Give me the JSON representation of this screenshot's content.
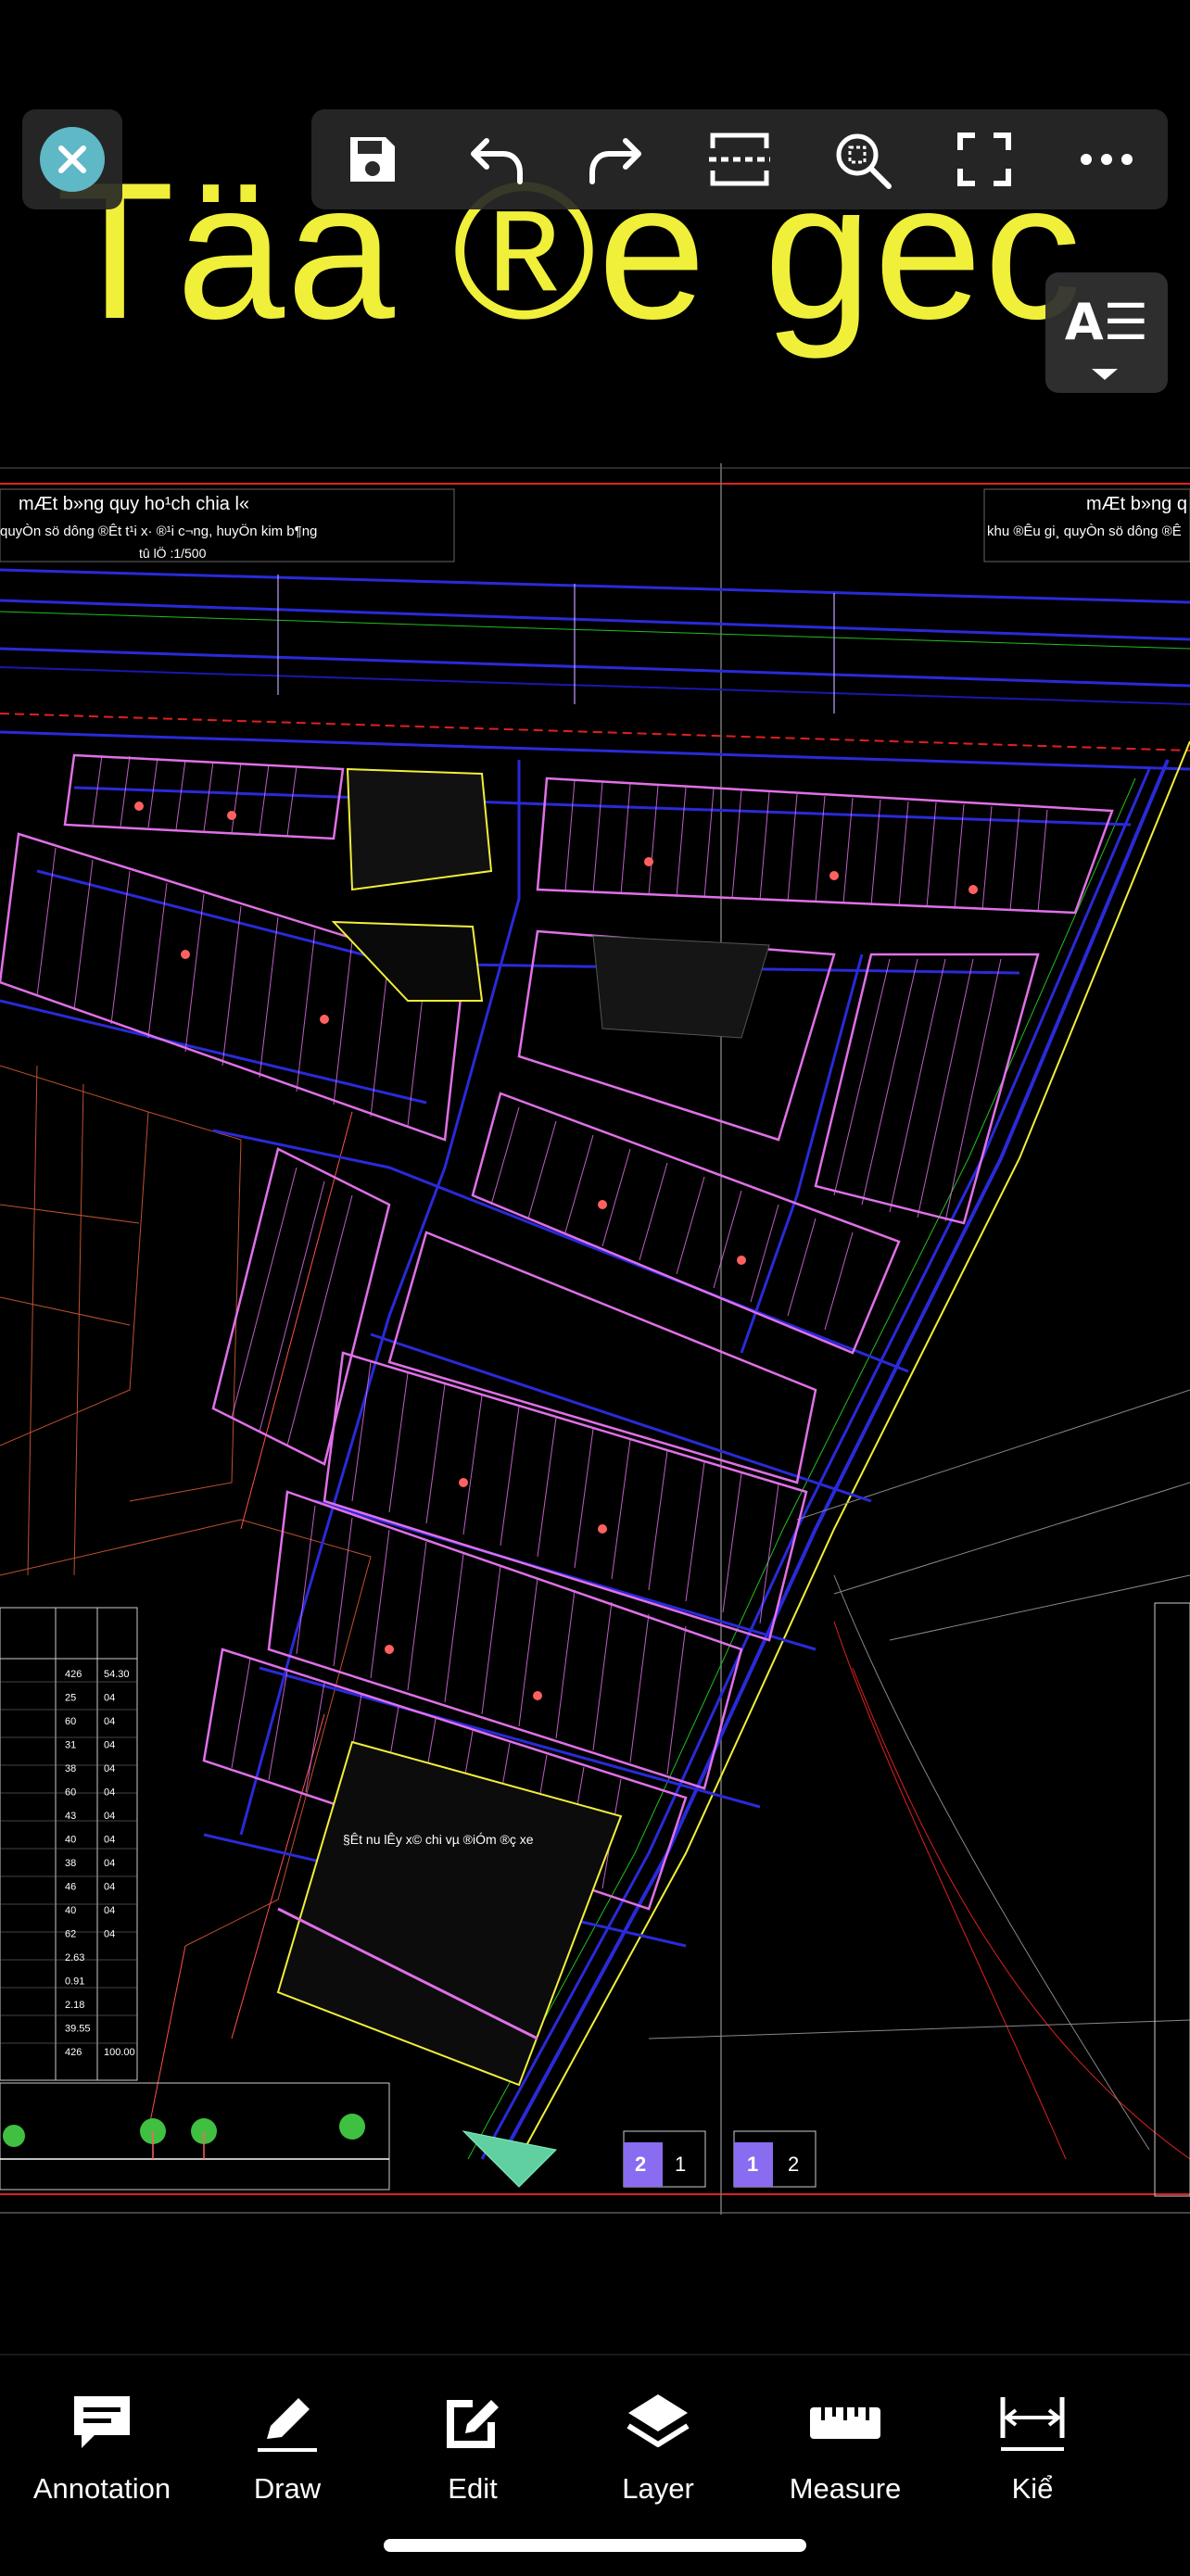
{
  "drawing": {
    "big_title": "Täa ®e gec",
    "title_left_line1": "mÆt b»ng quy ho¹ch chia l«",
    "title_left_line2": "quyÒn sö dông ®Êt t¹i x· ®¹i c­¬ng, huyÖn kim b¶ng",
    "title_left_line3": "tû lÖ :1/500",
    "title_right_line1": "mÆt b»ng q",
    "title_right_line2": "khu ®Êu gi¸ quyÒn sö dông ®Ê",
    "area_label": "§Êt nu lÊy x© chi vµ ®iÓm ®ç xe",
    "page_box_a": [
      "2",
      "1"
    ],
    "page_box_b": [
      "1",
      "2"
    ],
    "table_values": [
      "426",
      "25",
      "60",
      "31",
      "38",
      "60",
      "43",
      "40",
      "38",
      "46",
      "40",
      "62",
      "2.63",
      "0.91",
      "2.18",
      "39.55",
      "426"
    ],
    "table_units": [
      "54.30",
      "04",
      "04",
      "04",
      "04",
      "04",
      "04",
      "04",
      "04",
      "04",
      "04",
      "04",
      "",
      "",
      "",
      "",
      "100.00"
    ]
  },
  "top_toolbar": {
    "icons": [
      "save-icon",
      "undo-icon",
      "redo-icon",
      "scan-area-icon",
      "zoom-select-icon",
      "fullscreen-icon",
      "more-icon"
    ]
  },
  "side_button": {
    "label": "A☰"
  },
  "bottom_tools": [
    {
      "label": "Annotation",
      "icon": "annotation-icon"
    },
    {
      "label": "Draw",
      "icon": "pencil-icon"
    },
    {
      "label": "Edit",
      "icon": "edit-icon"
    },
    {
      "label": "Layer",
      "icon": "layers-icon"
    },
    {
      "label": "Measure",
      "icon": "ruler-icon"
    },
    {
      "label": "Kiể",
      "icon": "dimension-icon"
    }
  ],
  "colors": {
    "background": "#000000",
    "title_yellow": "#f0ef3a",
    "close_teal": "#5fb8c6",
    "lot_magenta": "#e070e8",
    "road_blue": "#2020d0",
    "border_red": "#e02020"
  }
}
